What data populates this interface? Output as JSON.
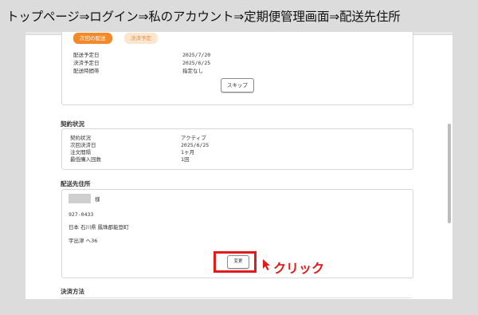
{
  "heading": "トップページ⇒ログイン⇒私のアカウント⇒定期便管理画面⇒配送先住所",
  "next_delivery": {
    "badge_next": "次回の配送",
    "badge_scheduled": "決済予定",
    "rows": [
      {
        "label": "配送予定日",
        "value": "2025/7/20"
      },
      {
        "label": "決済予定日",
        "value": "2025/6/25"
      },
      {
        "label": "配送時間帯",
        "value": "指定なし"
      }
    ],
    "skip_label": "スキップ"
  },
  "contract": {
    "title": "契約状況",
    "rows": [
      {
        "label": "契約状況",
        "value": "アクティブ"
      },
      {
        "label": "次回決済日",
        "value": "2025/6/25"
      },
      {
        "label": "注文間隔",
        "value": "1ヶ月"
      },
      {
        "label": "最低購入回数",
        "value": "1回"
      }
    ]
  },
  "address": {
    "title": "配送先住所",
    "honorific": "様",
    "postal": "927-0433",
    "line1": "日本 石川県 鳳珠郡能登町",
    "line2": "宇出津 へ36",
    "change_label": "変更"
  },
  "payment": {
    "title": "決済方法"
  },
  "annotation": {
    "label": "クリック",
    "color": "#e21a1a"
  },
  "colors": {
    "accent_orange": "#f08a2a",
    "accent_peach": "#fde6cf",
    "highlight_red": "#e21a1a"
  }
}
